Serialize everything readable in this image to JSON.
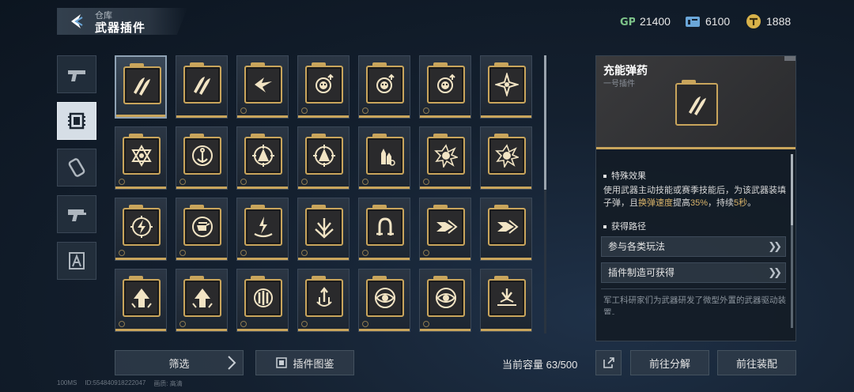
{
  "header": {
    "subtitle": "仓库",
    "title": "武器插件"
  },
  "currencies": [
    {
      "icon": "gp-icon",
      "value": "21400"
    },
    {
      "icon": "card-icon",
      "value": "6100"
    },
    {
      "icon": "coin-icon",
      "value": "1888"
    }
  ],
  "side_tabs": [
    {
      "name": "side-tab-pistol",
      "icon": "pistol-icon"
    },
    {
      "name": "side-tab-plugin",
      "icon": "chip-icon",
      "active": true
    },
    {
      "name": "side-tab-attachment",
      "icon": "attachment-icon"
    },
    {
      "name": "side-tab-gun",
      "icon": "gun-icon"
    },
    {
      "name": "side-tab-badge",
      "icon": "badge-icon"
    }
  ],
  "grid": {
    "rows": [
      [
        "bullets-icon",
        "bullets-icon",
        "dash-wing-icon",
        "skull-up-icon",
        "skull-up-icon",
        "skull-up-icon",
        "star-diamond-icon"
      ],
      [
        "hexagram-icon",
        "anchor-icon",
        "target-a-icon",
        "target-a-icon",
        "rockets-icon",
        "burst-icon",
        "burst-icon"
      ],
      [
        "bolt-target-icon",
        "fist-icon",
        "bolt-hand-icon",
        "trident-icon",
        "horseshoe-icon",
        "arrow-right-icon",
        "arrow-right-icon"
      ],
      [
        "arrows-up-icon",
        "arrows-up-icon",
        "shield-bars-icon",
        "rocket-down-icon",
        "eye-icon",
        "eye-icon",
        "impact-icon"
      ]
    ]
  },
  "detail": {
    "name": "充能弹药",
    "type": "一号插件",
    "effect_title": "特殊效果",
    "effect_line1": "使用武器主动技能或赛季技能后，为该武器装填",
    "effect_line2_a": "子弹，且",
    "effect_hl1": "换弹速度",
    "effect_line2_b": "提高",
    "effect_hl2": "35%",
    "effect_line2_c": "，持续",
    "effect_hl3": "5秒",
    "effect_line2_d": "。",
    "source_title": "获得路径",
    "sources": [
      "参与各类玩法",
      "插件制造可获得"
    ],
    "description": "军工科研家们为武器研发了微型外置的武器驱动装置。"
  },
  "bottom": {
    "filter_label": "筛选",
    "codex_label": "插件图鉴",
    "capacity_label": "当前容量 63/500",
    "decompose_label": "前往分解",
    "equip_label": "前往装配"
  },
  "status": {
    "ping": "100MS",
    "id": "ID:554840918222047",
    "quality": "画质: 高清"
  },
  "colors": {
    "gold": "#c9a55c",
    "gp_green": "#7ec48a",
    "card_blue": "#6aa6d8",
    "coin_gold": "#d8b24a"
  }
}
